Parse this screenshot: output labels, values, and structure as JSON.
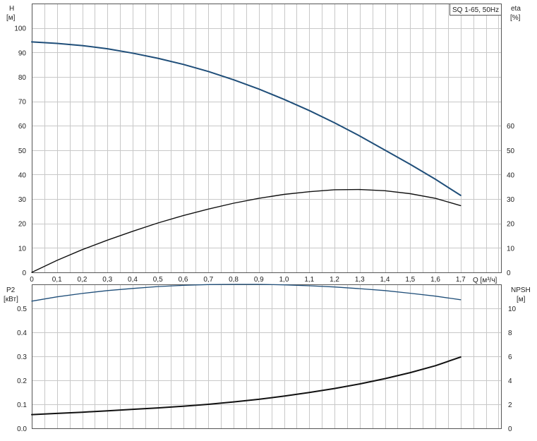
{
  "chart_data": [
    {
      "type": "line",
      "title": "SQ 1-65, 50Hz",
      "left_axis": {
        "label": "H",
        "unit": "[м]",
        "ticks": [
          0,
          10,
          20,
          30,
          40,
          50,
          60,
          70,
          80,
          90,
          100
        ],
        "range": [
          0,
          110
        ]
      },
      "right_axis": {
        "label": "eta",
        "unit": "[%]",
        "ticks": [
          0,
          10,
          20,
          30,
          40,
          50,
          60
        ],
        "range": [
          0,
          110
        ]
      },
      "x_axis": {
        "label": "Q [м³/ч]",
        "ticks": [
          "0",
          "0,1",
          "0,2",
          "0,3",
          "0,4",
          "0,5",
          "0,6",
          "0,7",
          "0,8",
          "0,9",
          "1,0",
          "1,1",
          "1,2",
          "1,3",
          "1,4",
          "1,5",
          "1,6",
          "1,7"
        ],
        "range": [
          0,
          1.86
        ]
      },
      "grid": true,
      "series": [
        {
          "key": "H",
          "axis": "left",
          "color": "#1f4e79",
          "x": [
            0,
            0.1,
            0.2,
            0.3,
            0.4,
            0.5,
            0.6,
            0.7,
            0.8,
            0.9,
            1.0,
            1.1,
            1.2,
            1.3,
            1.4,
            1.5,
            1.6,
            1.7
          ],
          "y": [
            94.3,
            93.7,
            92.8,
            91.5,
            89.7,
            87.6,
            85.1,
            82.2,
            78.8,
            75.0,
            70.8,
            66.2,
            61.2,
            55.8,
            50.0,
            44.2,
            38.1,
            31.5
          ]
        },
        {
          "key": "eta",
          "axis": "right",
          "color": "#111111",
          "x": [
            0,
            0.1,
            0.2,
            0.3,
            0.4,
            0.5,
            0.6,
            0.7,
            0.8,
            0.9,
            1.0,
            1.1,
            1.2,
            1.3,
            1.4,
            1.5,
            1.6,
            1.7
          ],
          "y": [
            0,
            4.9,
            9.3,
            13.2,
            16.8,
            20.2,
            23.2,
            25.9,
            28.3,
            30.3,
            31.9,
            33.0,
            33.8,
            33.9,
            33.4,
            32.2,
            30.3,
            27.3
          ]
        }
      ]
    },
    {
      "type": "line",
      "left_axis": {
        "label": "P2",
        "unit": "[кВт]",
        "ticks": [
          "0.0",
          "0.1",
          "0.2",
          "0.3",
          "0.4",
          "0.5"
        ],
        "range": [
          0,
          0.6
        ]
      },
      "right_axis": {
        "label": "NPSH",
        "unit": "[м]",
        "ticks": [
          0,
          2,
          4,
          6,
          8,
          10
        ],
        "range": [
          0,
          12
        ]
      },
      "x_axis": {
        "range": [
          0,
          1.86
        ]
      },
      "grid": true,
      "series": [
        {
          "key": "P2_upper",
          "axis": "left",
          "color": "#1f4e79",
          "x": [
            0,
            0.1,
            0.2,
            0.3,
            0.4,
            0.5,
            0.6,
            0.7,
            0.8,
            0.9,
            1.0,
            1.1,
            1.2,
            1.3,
            1.4,
            1.5,
            1.6,
            1.7
          ],
          "y": [
            0.53,
            0.548,
            0.562,
            0.574,
            0.583,
            0.591,
            0.596,
            0.599,
            0.6,
            0.6,
            0.598,
            0.594,
            0.589,
            0.582,
            0.574,
            0.563,
            0.551,
            0.536
          ]
        },
        {
          "key": "P2_lower",
          "axis": "left",
          "color": "#111111",
          "x": [
            0,
            0.1,
            0.2,
            0.3,
            0.4,
            0.5,
            0.6,
            0.7,
            0.8,
            0.9,
            1.0,
            1.1,
            1.2,
            1.3,
            1.4,
            1.5,
            1.6,
            1.7
          ],
          "y": [
            0.057,
            0.062,
            0.067,
            0.073,
            0.079,
            0.085,
            0.092,
            0.1,
            0.11,
            0.121,
            0.134,
            0.149,
            0.166,
            0.185,
            0.207,
            0.232,
            0.261,
            0.297
          ]
        }
      ]
    }
  ]
}
